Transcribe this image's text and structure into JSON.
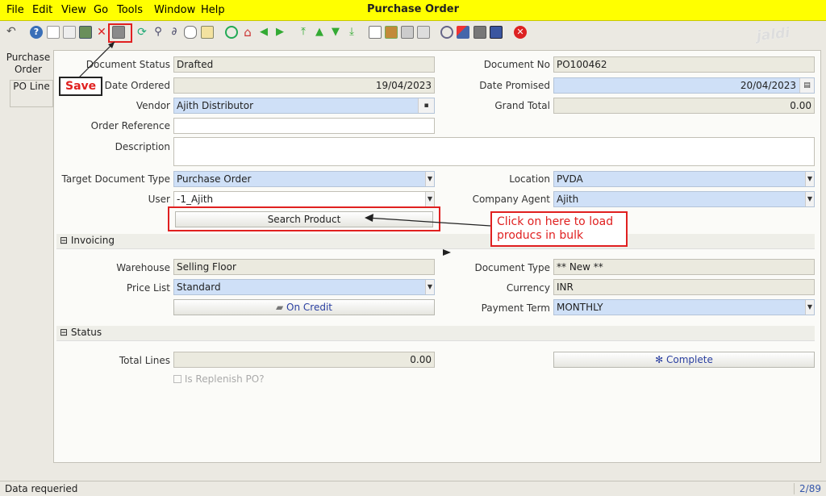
{
  "menu": {
    "items": [
      "File",
      "Edit",
      "View",
      "Go",
      "Tools",
      "Window",
      "Help"
    ],
    "title": "Purchase Order"
  },
  "toolbar": {
    "icons": [
      "undo-icon",
      "help-icon",
      "new-icon",
      "copy-icon",
      "save-icon",
      "delete-icon",
      "save-record-icon",
      "refresh-icon",
      "find-icon",
      "attachment-icon",
      "chat-icon",
      "history-icon",
      "home-icon",
      "back-icon",
      "forward-icon",
      "first-icon",
      "previous-icon",
      "next-icon",
      "last-icon",
      "report-icon",
      "archive-icon",
      "print-icon",
      "print-preview-icon",
      "zoom-across-icon",
      "workflow-icon",
      "request-icon",
      "product-info-icon",
      "close-icon"
    ]
  },
  "logo": "jaldi",
  "tabs": {
    "t1": "Purchase Order",
    "t2": "PO Line"
  },
  "form": {
    "document_status": {
      "label": "Document Status",
      "value": "Drafted"
    },
    "document_no": {
      "label": "Document No",
      "value": "PO100462"
    },
    "date_ordered": {
      "label": "Date Ordered",
      "value": "19/04/2023"
    },
    "date_promised": {
      "label": "Date Promised",
      "value": "20/04/2023"
    },
    "vendor": {
      "label": "Vendor",
      "value": "Ajith Distributor"
    },
    "grand_total": {
      "label": "Grand Total",
      "value": "0.00"
    },
    "order_reference": {
      "label": "Order Reference",
      "value": ""
    },
    "description": {
      "label": "Description",
      "value": ""
    },
    "target_document_type": {
      "label": "Target Document Type",
      "value": "Purchase Order"
    },
    "location": {
      "label": "Location",
      "value": "PVDA"
    },
    "user": {
      "label": "User",
      "value": "-1_Ajith"
    },
    "company_agent": {
      "label": "Company Agent",
      "value": "Ajith"
    },
    "search_product": "Search Product"
  },
  "invoicing": {
    "header": "Invoicing",
    "warehouse": {
      "label": "Warehouse",
      "value": "Selling Floor"
    },
    "document_type": {
      "label": "Document Type",
      "value": "** New **"
    },
    "price_list": {
      "label": "Price List",
      "value": "Standard"
    },
    "currency": {
      "label": "Currency",
      "value": "INR"
    },
    "on_credit": "On Credit",
    "payment_term": {
      "label": "Payment Term",
      "value": "MONTHLY"
    }
  },
  "status": {
    "header": "Status",
    "total_lines": {
      "label": "Total Lines",
      "value": "0.00"
    },
    "complete": "Complete",
    "is_replenish": "Is Replenish PO?"
  },
  "statusbar": {
    "message": "Data requeried",
    "record": "2/89"
  },
  "annotations": {
    "save": "Save",
    "search": "Click on here to load producs in bulk"
  }
}
